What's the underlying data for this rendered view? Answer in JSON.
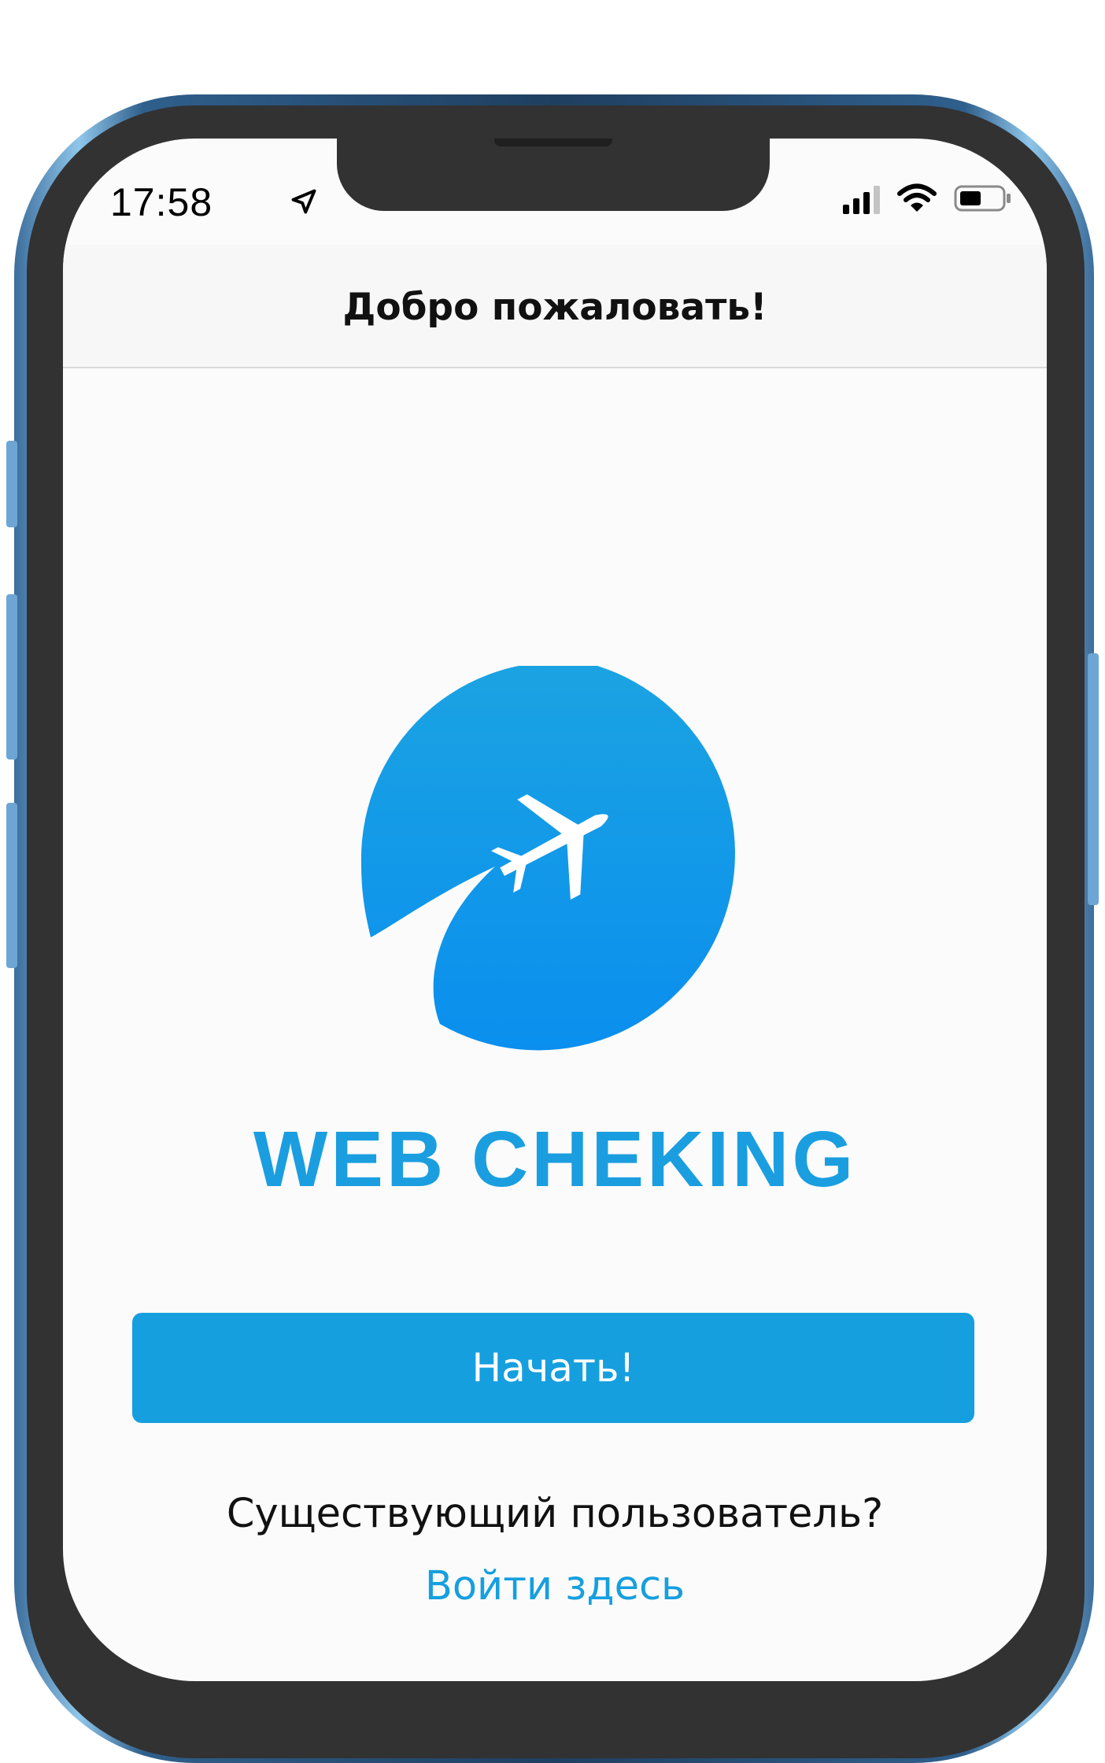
{
  "status_bar": {
    "time": "17:58",
    "icons": [
      "location-arrow-icon",
      "cellular-signal-icon",
      "wifi-icon",
      "battery-icon"
    ]
  },
  "header": {
    "title": "Добро пожаловать!"
  },
  "logo": {
    "icon": "airplane-logo",
    "brand_name": "WEB CHEKING"
  },
  "actions": {
    "start_label": "Начать!",
    "existing_user_text": "Существующий пользователь?",
    "login_link_label": "Войти здесь"
  },
  "colors": {
    "accent": "#159fdf",
    "brand_text": "#1a9ee0",
    "header_bg": "#f7f7f7",
    "screen_bg": "#fbfbfb",
    "bezel": "#323232"
  }
}
